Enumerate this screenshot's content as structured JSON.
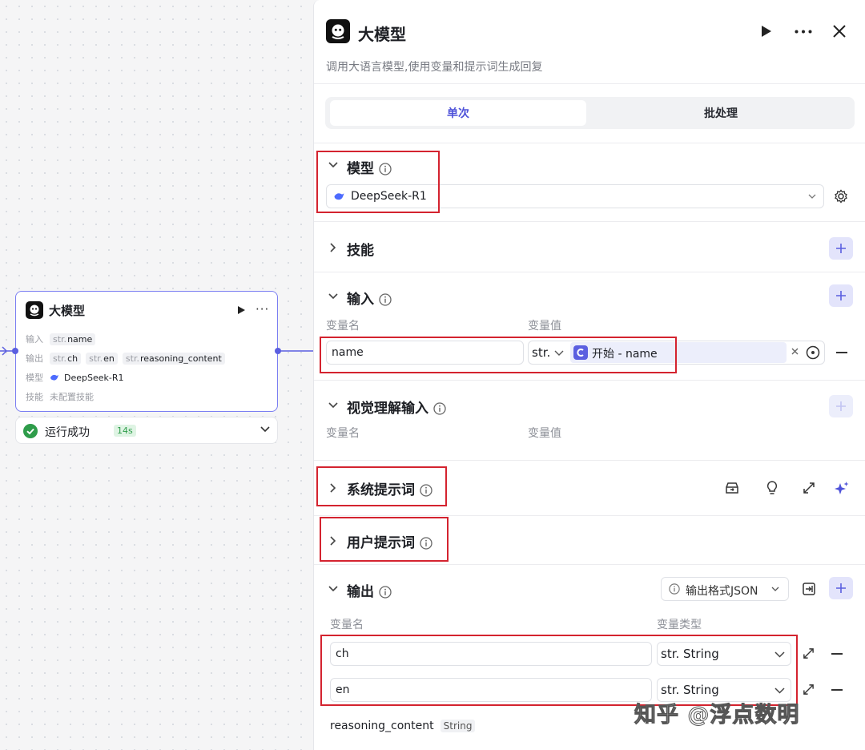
{
  "node": {
    "title": "大模型",
    "more": "···",
    "input_label": "输入",
    "input_chip": {
      "type": "str.",
      "name": "name"
    },
    "output_label": "输出",
    "output_chips": [
      {
        "type": "str.",
        "name": "ch"
      },
      {
        "type": "str.",
        "name": "en"
      },
      {
        "type": "str.",
        "name": "reasoning_content"
      }
    ],
    "model_label": "模型",
    "model_value": "DeepSeek-R1",
    "skills_label": "技能",
    "skills_value": "未配置技能",
    "status_text": "运行成功",
    "status_time": "14s"
  },
  "panel": {
    "title": "大模型",
    "description": "调用大语言模型,使用变量和提示词生成回复",
    "tabs": [
      {
        "label": "单次",
        "active": true
      },
      {
        "label": "批处理",
        "active": false
      }
    ],
    "model_section": {
      "title": "模型",
      "selected": "DeepSeek-R1"
    },
    "skills_section": {
      "title": "技能"
    },
    "input_section": {
      "title": "输入",
      "col_name": "变量名",
      "col_value": "变量值",
      "row": {
        "name": "name",
        "type": "str.",
        "ref_source": "开始",
        "ref_sep": " - ",
        "ref_var": "name"
      }
    },
    "vision_section": {
      "title": "视觉理解输入",
      "col_name": "变量名",
      "col_value": "变量值"
    },
    "system_prompt_section": {
      "title": "系统提示词"
    },
    "user_prompt_section": {
      "title": "用户提示词"
    },
    "output_section": {
      "title": "输出",
      "format_button": "输出格式JSON",
      "col_name": "变量名",
      "col_type": "变量类型",
      "rows": [
        {
          "name": "ch",
          "type": "str. String"
        },
        {
          "name": "en",
          "type": "str. String"
        }
      ],
      "reasoning": {
        "name": "reasoning_content",
        "type": "String"
      }
    }
  },
  "watermark": "知乎 @浮点数明",
  "colors": {
    "accent": "#5b5fe0",
    "highlight": "#d4232f",
    "success": "#2e9c4a"
  }
}
